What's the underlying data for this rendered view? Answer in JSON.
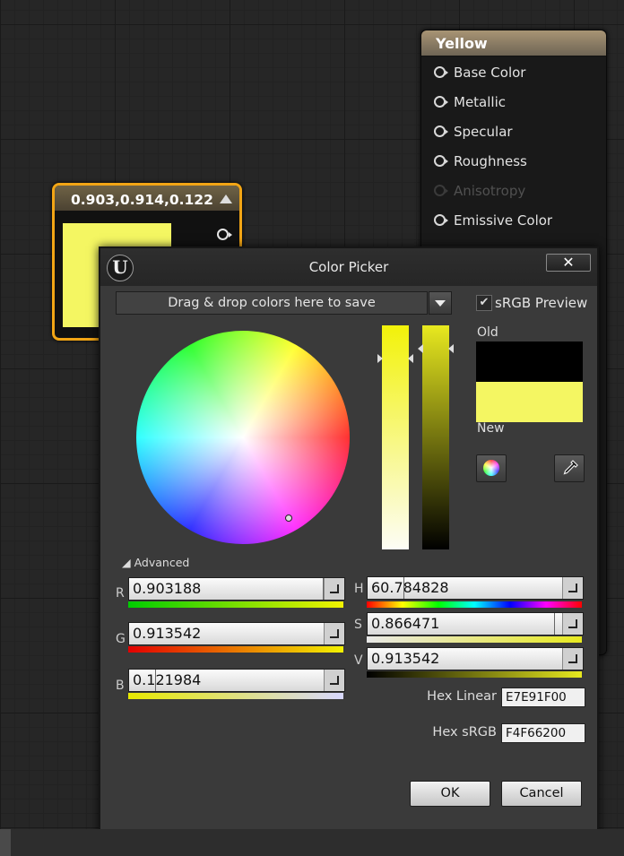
{
  "material_node": {
    "title": "Yellow",
    "pins": [
      {
        "label": "Base Color",
        "enabled": true
      },
      {
        "label": "Metallic",
        "enabled": true
      },
      {
        "label": "Specular",
        "enabled": true
      },
      {
        "label": "Roughness",
        "enabled": true
      },
      {
        "label": "Anisotropy",
        "enabled": false
      },
      {
        "label": "Emissive Color",
        "enabled": true
      }
    ]
  },
  "constant_node": {
    "title": "0.903,0.914,0.122",
    "swatch_color": "#F4F662",
    "border_color": "#F2A515"
  },
  "dialog": {
    "title": "Color Picker",
    "logo_text": "U",
    "close_label": "✕",
    "drop_placeholder": "Drag & drop colors here to save",
    "srgb_preview_label": "sRGB Preview",
    "srgb_preview_checked": true,
    "old_label": "Old",
    "new_label": "New",
    "old_color": "#000000",
    "new_color": "#F4F662",
    "advanced_label": "Advanced",
    "channels": {
      "r": {
        "label": "R",
        "value": "0.903188"
      },
      "g": {
        "label": "G",
        "value": "0.913542"
      },
      "b": {
        "label": "B",
        "value": "0.121984"
      },
      "h": {
        "label": "H",
        "value": "60.784828"
      },
      "s": {
        "label": "S",
        "value": "0.866471"
      },
      "v": {
        "label": "V",
        "value": "0.913542"
      }
    },
    "hex_linear_label": "Hex Linear",
    "hex_linear_value": "E7E91F00",
    "hex_srgb_label": "Hex sRGB",
    "hex_srgb_value": "F4F66200",
    "ok_label": "OK",
    "cancel_label": "Cancel"
  }
}
